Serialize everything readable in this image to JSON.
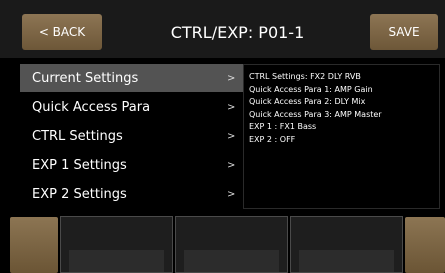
{
  "header": {
    "back_label": "< BACK",
    "title": "CTRL/EXP: P01-1",
    "save_label": "SAVE"
  },
  "menu": {
    "items": [
      {
        "label": "Current Settings",
        "chevron": ">"
      },
      {
        "label": "Quick Access Para",
        "chevron": ">"
      },
      {
        "label": "CTRL Settings",
        "chevron": ">"
      },
      {
        "label": "EXP 1 Settings",
        "chevron": ">"
      },
      {
        "label": "EXP 2 Settings",
        "chevron": ">"
      }
    ]
  },
  "info": {
    "lines": [
      "CTRL Settings: FX2 DLY RVB",
      "Quick Access Para 1: AMP Gain",
      "Quick Access Para 2: DLY Mix",
      "Quick Access Para 3: AMP Master",
      "EXP 1 : FX1 Bass",
      "EXP 2 : OFF"
    ]
  },
  "colors": {
    "accent_button": "#7d6646",
    "selected_row": "#535353",
    "background": "#000000"
  }
}
